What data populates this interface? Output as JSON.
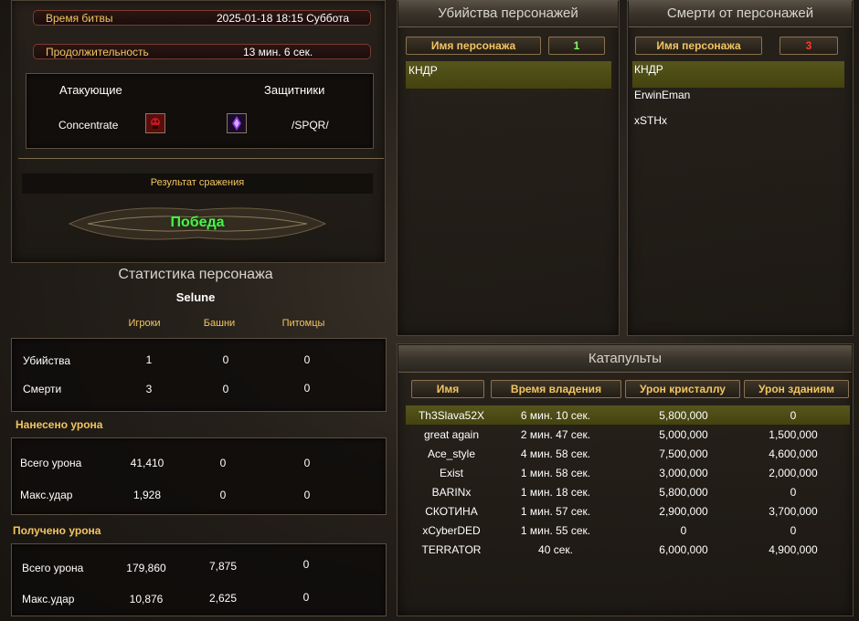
{
  "battle": {
    "time_label": "Время битвы",
    "time_value": "2025-01-18 18:15 Суббота",
    "duration_label": "Продолжительность",
    "duration_value": "13 мин. 6 сек.",
    "attackers_label": "Атакующие",
    "defenders_label": "Защитники",
    "attacker_name": "Concentrate",
    "defender_name": "/SPQR/",
    "result_label": "Результат сражения",
    "result_value": "Победа"
  },
  "char_stats": {
    "title": "Статистика персонажа",
    "name": "Selune",
    "col_players": "Игроки",
    "col_towers": "Башни",
    "col_pets": "Питомцы",
    "kills_label": "Убийства",
    "kills": [
      "1",
      "0",
      "0"
    ],
    "deaths_label": "Смерти",
    "deaths": [
      "3",
      "0",
      "0"
    ],
    "dealt_title": "Нанесено урона",
    "dealt_total_label": "Всего урона",
    "dealt_total": [
      "41,410",
      "0",
      "0"
    ],
    "dealt_max_label": "Макс.удар",
    "dealt_max": [
      "1,928",
      "0",
      "0"
    ],
    "taken_title": "Получено урона",
    "taken_total_label": "Всего урона",
    "taken_total": [
      "179,860",
      "7,875",
      "0"
    ],
    "taken_max_label": "Макс.удар",
    "taken_max": [
      "10,876",
      "2,625",
      "0"
    ]
  },
  "kills_panel": {
    "title": "Убийства персонажей",
    "col_name": "Имя персонажа",
    "count": "1",
    "rows": [
      "КНДР"
    ]
  },
  "deaths_panel": {
    "title": "Смерти от персонажей",
    "col_name": "Имя персонажа",
    "count": "3",
    "rows": [
      "КНДР",
      "ErwinEman",
      "xSTHx"
    ]
  },
  "catapults": {
    "title": "Катапульты",
    "col_name": "Имя",
    "col_time": "Время владения",
    "col_crystal": "Урон кристаллу",
    "col_buildings": "Урон зданиям",
    "rows": [
      {
        "name": "Th3Slava52X",
        "time": "6 мин. 10 сек.",
        "crystal": "5,800,000",
        "buildings": "0"
      },
      {
        "name": "great again",
        "time": "2 мин. 47 сек.",
        "crystal": "5,000,000",
        "buildings": "1,500,000"
      },
      {
        "name": "Ace_style",
        "time": "4 мин. 58 сек.",
        "crystal": "7,500,000",
        "buildings": "4,600,000"
      },
      {
        "name": "Exist",
        "time": "1 мин. 58 сек.",
        "crystal": "3,000,000",
        "buildings": "2,000,000"
      },
      {
        "name": "BARINx",
        "time": "1 мин. 18 сек.",
        "crystal": "5,800,000",
        "buildings": "0"
      },
      {
        "name": "СКОТИНА",
        "time": "1 мин. 57 сек.",
        "crystal": "2,900,000",
        "buildings": "3,700,000"
      },
      {
        "name": "xCyberDED",
        "time": "1 мин. 55 сек.",
        "crystal": "0",
        "buildings": "0"
      },
      {
        "name": "TERRATOR",
        "time": "40 сек.",
        "crystal": "6,000,000",
        "buildings": "4,900,000"
      }
    ]
  },
  "icons": {
    "attacker_emblem": "red-skull-emblem-icon",
    "defender_emblem": "purple-crystal-emblem-icon"
  },
  "colors": {
    "accent_gold": "#f2c562",
    "victory_green": "#4cf04c",
    "kill_count_green": "#7dff5c",
    "death_count_red": "#ff3a2a",
    "highlight_row": "#56551c"
  }
}
